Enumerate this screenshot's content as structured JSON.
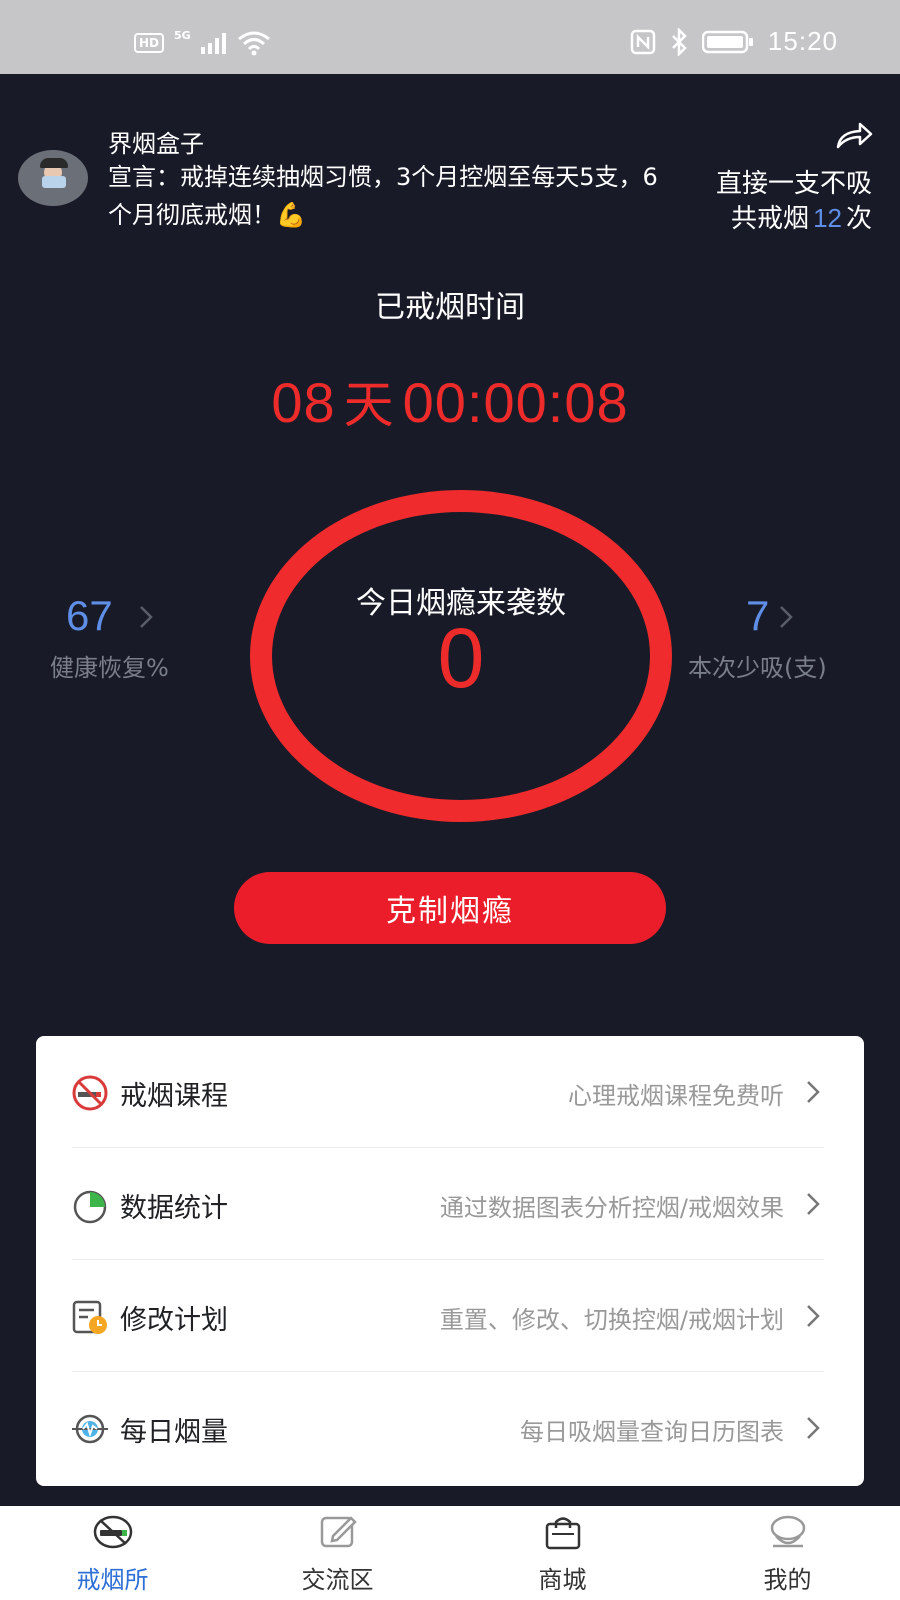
{
  "status_bar": {
    "network": "HD",
    "signal": "5G",
    "time": "15:20"
  },
  "header": {
    "username": "界烟盒子",
    "declaration": "宣言：戒掉连续抽烟习惯，3个月控烟至每天5支，6个月彻底戒烟！💪",
    "no_smoke_label": "直接一支不吸",
    "total_quit_prefix": "共戒烟",
    "total_quit_count": "12",
    "total_quit_suffix": "次"
  },
  "timer": {
    "label": "已戒烟时间",
    "days": "08",
    "days_unit": "天",
    "clock": "00:00:08"
  },
  "craving": {
    "label": "今日烟瘾来袭数",
    "count": "0"
  },
  "stats": {
    "health_value": "67",
    "health_label": "健康恢复%",
    "less_value": "7",
    "less_label": "本次少吸(支)"
  },
  "control_button": "克制烟瘾",
  "menu": [
    {
      "title": "戒烟课程",
      "desc": "心理戒烟课程免费听",
      "icon": "no-smoking-icon"
    },
    {
      "title": "数据统计",
      "desc": "通过数据图表分析控烟/戒烟效果",
      "icon": "pie-chart-icon"
    },
    {
      "title": "修改计划",
      "desc": "重置、修改、切换控烟/戒烟计划",
      "icon": "plan-clock-icon"
    },
    {
      "title": "每日烟量",
      "desc": "每日吸烟量查询日历图表",
      "icon": "target-pulse-icon"
    }
  ],
  "tabs": [
    {
      "label": "戒烟所",
      "icon": "no-smoking-tab-icon",
      "active": true
    },
    {
      "label": "交流区",
      "icon": "edit-icon",
      "active": false
    },
    {
      "label": "商城",
      "icon": "shopping-bag-icon",
      "active": false
    },
    {
      "label": "我的",
      "icon": "profile-icon",
      "active": false
    }
  ],
  "colors": {
    "background": "#181b27",
    "accent_red": "#ec1d2a",
    "accent_blue": "#5f8ee7",
    "tab_active": "#2d6fd6"
  }
}
